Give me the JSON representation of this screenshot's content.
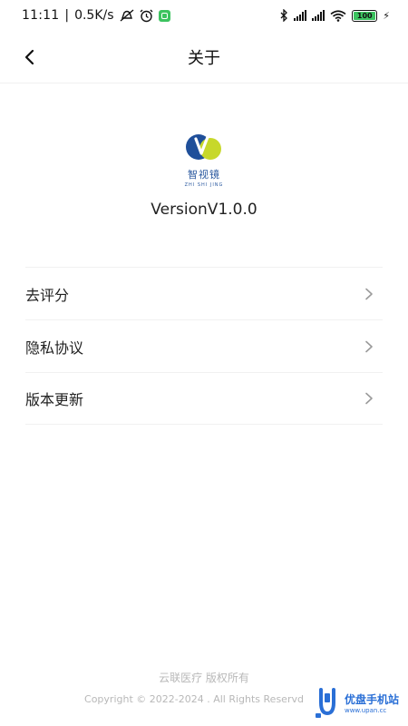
{
  "status_bar": {
    "time": "11:11",
    "separator": "|",
    "network_speed": "0.5K/s",
    "battery": "100",
    "icons": [
      "mute-icon",
      "alarm-icon",
      "wechat-icon",
      "bluetooth-icon",
      "signal-icon",
      "wifi-icon",
      "battery-icon",
      "charging-icon"
    ]
  },
  "header": {
    "title": "关于",
    "back_icon": "back-chevron-icon"
  },
  "app_info": {
    "logo_name": "智视镜",
    "logo_pinyin": "ZHI SHI JING",
    "version": "VersionV1.0.0"
  },
  "menu": {
    "items": [
      {
        "label": "去评分",
        "icon": "chevron-right-icon"
      },
      {
        "label": "隐私协议",
        "icon": "chevron-right-icon"
      },
      {
        "label": "版本更新",
        "icon": "chevron-right-icon"
      }
    ]
  },
  "footer": {
    "company": "云联医疗 版权所有",
    "copyright": "Copyright © 2022-2024 . All Rights Reservd"
  },
  "watermark": {
    "main": "优盘手机站",
    "sub": "www.upan.cc"
  },
  "colors": {
    "logo_blue": "#1f4f9a",
    "logo_green": "#c7d82b",
    "footer_text": "#b8b8b8",
    "watermark_blue": "#2a6fd6"
  }
}
